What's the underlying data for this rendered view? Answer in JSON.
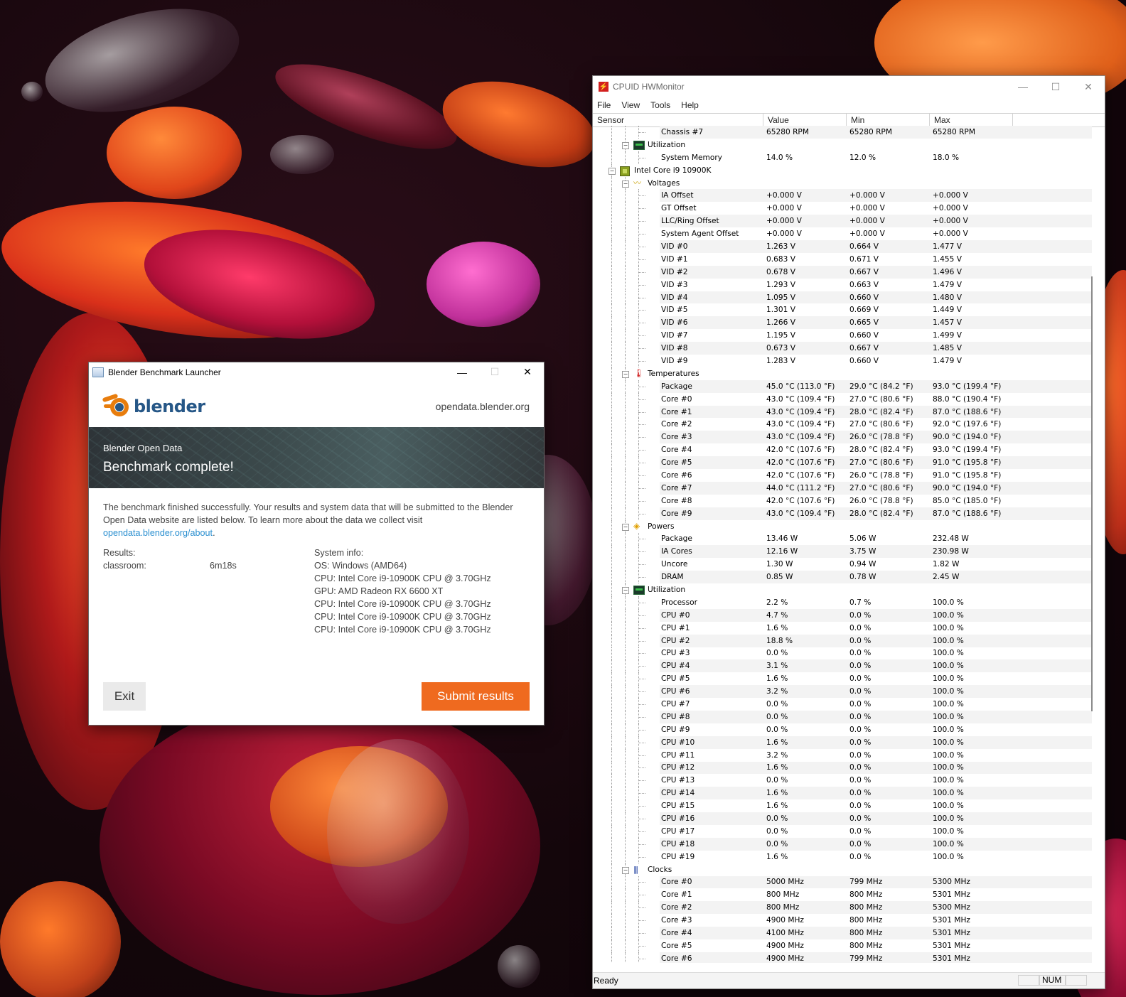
{
  "blender": {
    "window_title": "Blender Benchmark Launcher",
    "minimize_glyph": "—",
    "maximize_glyph": "☐",
    "close_glyph": "✕",
    "logo_text": "blender",
    "site": "opendata.blender.org",
    "banner_sub": "Blender Open Data",
    "banner_title": "Benchmark complete!",
    "body_text": "The benchmark finished successfully. Your results and system data that will be submitted to the Blender Open Data website are listed below. To learn more about the data we collect visit",
    "link_text": "opendata.blender.org/about",
    "link_suffix": ".",
    "results_label": "Results:",
    "results": [
      {
        "name": "classroom:",
        "value": "6m18s"
      }
    ],
    "sysinfo_label": "System info:",
    "sysinfo": [
      "OS: Windows (AMD64)",
      "CPU: Intel Core i9-10900K CPU @ 3.70GHz",
      "GPU: AMD Radeon RX 6600 XT",
      "CPU: Intel Core i9-10900K CPU @ 3.70GHz",
      "CPU: Intel Core i9-10900K CPU @ 3.70GHz",
      "CPU: Intel Core i9-10900K CPU @ 3.70GHz"
    ],
    "exit_label": "Exit",
    "submit_label": "Submit results",
    "accent_color": "#ef6a1f"
  },
  "hwmonitor": {
    "app_icon": "⚡",
    "window_title": "CPUID HWMonitor",
    "minimize_glyph": "—",
    "maximize_glyph": "☐",
    "close_glyph": "✕",
    "menu": [
      "File",
      "View",
      "Tools",
      "Help"
    ],
    "columns": [
      "Sensor",
      "Value",
      "Min",
      "Max"
    ],
    "rows": [
      {
        "t": "leaf",
        "name": "Chassis #7",
        "v": "65280 RPM",
        "mn": "65280 RPM",
        "mx": "65280 RPM"
      },
      {
        "t": "group",
        "icon": "util",
        "name": "Utilization"
      },
      {
        "t": "leaf",
        "name": "System Memory",
        "v": "14.0 %",
        "mn": "12.0 %",
        "mx": "18.0 %"
      },
      {
        "t": "device",
        "name": "Intel Core i9 10900K"
      },
      {
        "t": "group",
        "icon": "volt",
        "name": "Voltages"
      },
      {
        "t": "leaf",
        "name": "IA Offset",
        "v": "+0.000 V",
        "mn": "+0.000 V",
        "mx": "+0.000 V"
      },
      {
        "t": "leaf",
        "name": "GT Offset",
        "v": "+0.000 V",
        "mn": "+0.000 V",
        "mx": "+0.000 V"
      },
      {
        "t": "leaf",
        "name": "LLC/Ring Offset",
        "v": "+0.000 V",
        "mn": "+0.000 V",
        "mx": "+0.000 V"
      },
      {
        "t": "leaf",
        "name": "System Agent Offset",
        "v": "+0.000 V",
        "mn": "+0.000 V",
        "mx": "+0.000 V"
      },
      {
        "t": "leaf",
        "name": "VID #0",
        "v": "1.263 V",
        "mn": "0.664 V",
        "mx": "1.477 V"
      },
      {
        "t": "leaf",
        "name": "VID #1",
        "v": "0.683 V",
        "mn": "0.671 V",
        "mx": "1.455 V"
      },
      {
        "t": "leaf",
        "name": "VID #2",
        "v": "0.678 V",
        "mn": "0.667 V",
        "mx": "1.496 V"
      },
      {
        "t": "leaf",
        "name": "VID #3",
        "v": "1.293 V",
        "mn": "0.663 V",
        "mx": "1.479 V"
      },
      {
        "t": "leaf",
        "name": "VID #4",
        "v": "1.095 V",
        "mn": "0.660 V",
        "mx": "1.480 V"
      },
      {
        "t": "leaf",
        "name": "VID #5",
        "v": "1.301 V",
        "mn": "0.669 V",
        "mx": "1.449 V"
      },
      {
        "t": "leaf",
        "name": "VID #6",
        "v": "1.266 V",
        "mn": "0.665 V",
        "mx": "1.457 V"
      },
      {
        "t": "leaf",
        "name": "VID #7",
        "v": "1.195 V",
        "mn": "0.660 V",
        "mx": "1.499 V"
      },
      {
        "t": "leaf",
        "name": "VID #8",
        "v": "0.673 V",
        "mn": "0.667 V",
        "mx": "1.485 V"
      },
      {
        "t": "leaf",
        "name": "VID #9",
        "v": "1.283 V",
        "mn": "0.660 V",
        "mx": "1.479 V"
      },
      {
        "t": "group",
        "icon": "temp",
        "name": "Temperatures"
      },
      {
        "t": "leaf",
        "name": "Package",
        "v": "45.0 °C  (113.0 °F)",
        "mn": "29.0 °C  (84.2 °F)",
        "mx": "93.0 °C  (199.4 °F)"
      },
      {
        "t": "leaf",
        "name": "Core #0",
        "v": "43.0 °C  (109.4 °F)",
        "mn": "27.0 °C  (80.6 °F)",
        "mx": "88.0 °C  (190.4 °F)"
      },
      {
        "t": "leaf",
        "name": "Core #1",
        "v": "43.0 °C  (109.4 °F)",
        "mn": "28.0 °C  (82.4 °F)",
        "mx": "87.0 °C  (188.6 °F)"
      },
      {
        "t": "leaf",
        "name": "Core #2",
        "v": "43.0 °C  (109.4 °F)",
        "mn": "27.0 °C  (80.6 °F)",
        "mx": "92.0 °C  (197.6 °F)"
      },
      {
        "t": "leaf",
        "name": "Core #3",
        "v": "43.0 °C  (109.4 °F)",
        "mn": "26.0 °C  (78.8 °F)",
        "mx": "90.0 °C  (194.0 °F)"
      },
      {
        "t": "leaf",
        "name": "Core #4",
        "v": "42.0 °C  (107.6 °F)",
        "mn": "28.0 °C  (82.4 °F)",
        "mx": "93.0 °C  (199.4 °F)"
      },
      {
        "t": "leaf",
        "name": "Core #5",
        "v": "42.0 °C  (107.6 °F)",
        "mn": "27.0 °C  (80.6 °F)",
        "mx": "91.0 °C  (195.8 °F)"
      },
      {
        "t": "leaf",
        "name": "Core #6",
        "v": "42.0 °C  (107.6 °F)",
        "mn": "26.0 °C  (78.8 °F)",
        "mx": "91.0 °C  (195.8 °F)"
      },
      {
        "t": "leaf",
        "name": "Core #7",
        "v": "44.0 °C  (111.2 °F)",
        "mn": "27.0 °C  (80.6 °F)",
        "mx": "90.0 °C  (194.0 °F)"
      },
      {
        "t": "leaf",
        "name": "Core #8",
        "v": "42.0 °C  (107.6 °F)",
        "mn": "26.0 °C  (78.8 °F)",
        "mx": "85.0 °C  (185.0 °F)"
      },
      {
        "t": "leaf",
        "name": "Core #9",
        "v": "43.0 °C  (109.4 °F)",
        "mn": "28.0 °C  (82.4 °F)",
        "mx": "87.0 °C  (188.6 °F)"
      },
      {
        "t": "group",
        "icon": "power",
        "name": "Powers"
      },
      {
        "t": "leaf",
        "name": "Package",
        "v": "13.46 W",
        "mn": "5.06 W",
        "mx": "232.48 W"
      },
      {
        "t": "leaf",
        "name": "IA Cores",
        "v": "12.16 W",
        "mn": "3.75 W",
        "mx": "230.98 W"
      },
      {
        "t": "leaf",
        "name": "Uncore",
        "v": "1.30 W",
        "mn": "0.94 W",
        "mx": "1.82 W"
      },
      {
        "t": "leaf",
        "name": "DRAM",
        "v": "0.85 W",
        "mn": "0.78 W",
        "mx": "2.45 W"
      },
      {
        "t": "group",
        "icon": "util",
        "name": "Utilization"
      },
      {
        "t": "leaf",
        "name": "Processor",
        "v": "2.2 %",
        "mn": "0.7 %",
        "mx": "100.0 %"
      },
      {
        "t": "leaf",
        "name": "CPU #0",
        "v": "4.7 %",
        "mn": "0.0 %",
        "mx": "100.0 %"
      },
      {
        "t": "leaf",
        "name": "CPU #1",
        "v": "1.6 %",
        "mn": "0.0 %",
        "mx": "100.0 %"
      },
      {
        "t": "leaf",
        "name": "CPU #2",
        "v": "18.8 %",
        "mn": "0.0 %",
        "mx": "100.0 %"
      },
      {
        "t": "leaf",
        "name": "CPU #3",
        "v": "0.0 %",
        "mn": "0.0 %",
        "mx": "100.0 %"
      },
      {
        "t": "leaf",
        "name": "CPU #4",
        "v": "3.1 %",
        "mn": "0.0 %",
        "mx": "100.0 %"
      },
      {
        "t": "leaf",
        "name": "CPU #5",
        "v": "1.6 %",
        "mn": "0.0 %",
        "mx": "100.0 %"
      },
      {
        "t": "leaf",
        "name": "CPU #6",
        "v": "3.2 %",
        "mn": "0.0 %",
        "mx": "100.0 %"
      },
      {
        "t": "leaf",
        "name": "CPU #7",
        "v": "0.0 %",
        "mn": "0.0 %",
        "mx": "100.0 %"
      },
      {
        "t": "leaf",
        "name": "CPU #8",
        "v": "0.0 %",
        "mn": "0.0 %",
        "mx": "100.0 %"
      },
      {
        "t": "leaf",
        "name": "CPU #9",
        "v": "0.0 %",
        "mn": "0.0 %",
        "mx": "100.0 %"
      },
      {
        "t": "leaf",
        "name": "CPU #10",
        "v": "1.6 %",
        "mn": "0.0 %",
        "mx": "100.0 %"
      },
      {
        "t": "leaf",
        "name": "CPU #11",
        "v": "3.2 %",
        "mn": "0.0 %",
        "mx": "100.0 %"
      },
      {
        "t": "leaf",
        "name": "CPU #12",
        "v": "1.6 %",
        "mn": "0.0 %",
        "mx": "100.0 %"
      },
      {
        "t": "leaf",
        "name": "CPU #13",
        "v": "0.0 %",
        "mn": "0.0 %",
        "mx": "100.0 %"
      },
      {
        "t": "leaf",
        "name": "CPU #14",
        "v": "1.6 %",
        "mn": "0.0 %",
        "mx": "100.0 %"
      },
      {
        "t": "leaf",
        "name": "CPU #15",
        "v": "1.6 %",
        "mn": "0.0 %",
        "mx": "100.0 %"
      },
      {
        "t": "leaf",
        "name": "CPU #16",
        "v": "0.0 %",
        "mn": "0.0 %",
        "mx": "100.0 %"
      },
      {
        "t": "leaf",
        "name": "CPU #17",
        "v": "0.0 %",
        "mn": "0.0 %",
        "mx": "100.0 %"
      },
      {
        "t": "leaf",
        "name": "CPU #18",
        "v": "0.0 %",
        "mn": "0.0 %",
        "mx": "100.0 %"
      },
      {
        "t": "leaf",
        "name": "CPU #19",
        "v": "1.6 %",
        "mn": "0.0 %",
        "mx": "100.0 %"
      },
      {
        "t": "group",
        "icon": "clock",
        "name": "Clocks"
      },
      {
        "t": "leaf",
        "name": "Core #0",
        "v": "5000 MHz",
        "mn": "799 MHz",
        "mx": "5300 MHz"
      },
      {
        "t": "leaf",
        "name": "Core #1",
        "v": "800 MHz",
        "mn": "800 MHz",
        "mx": "5301 MHz"
      },
      {
        "t": "leaf",
        "name": "Core #2",
        "v": "800 MHz",
        "mn": "800 MHz",
        "mx": "5300 MHz"
      },
      {
        "t": "leaf",
        "name": "Core #3",
        "v": "4900 MHz",
        "mn": "800 MHz",
        "mx": "5301 MHz"
      },
      {
        "t": "leaf",
        "name": "Core #4",
        "v": "4100 MHz",
        "mn": "800 MHz",
        "mx": "5301 MHz"
      },
      {
        "t": "leaf",
        "name": "Core #5",
        "v": "4900 MHz",
        "mn": "800 MHz",
        "mx": "5301 MHz"
      },
      {
        "t": "leaf",
        "name": "Core #6",
        "v": "4900 MHz",
        "mn": "799 MHz",
        "mx": "5301 MHz"
      }
    ],
    "status_ready": "Ready",
    "status_num": "NUM"
  }
}
